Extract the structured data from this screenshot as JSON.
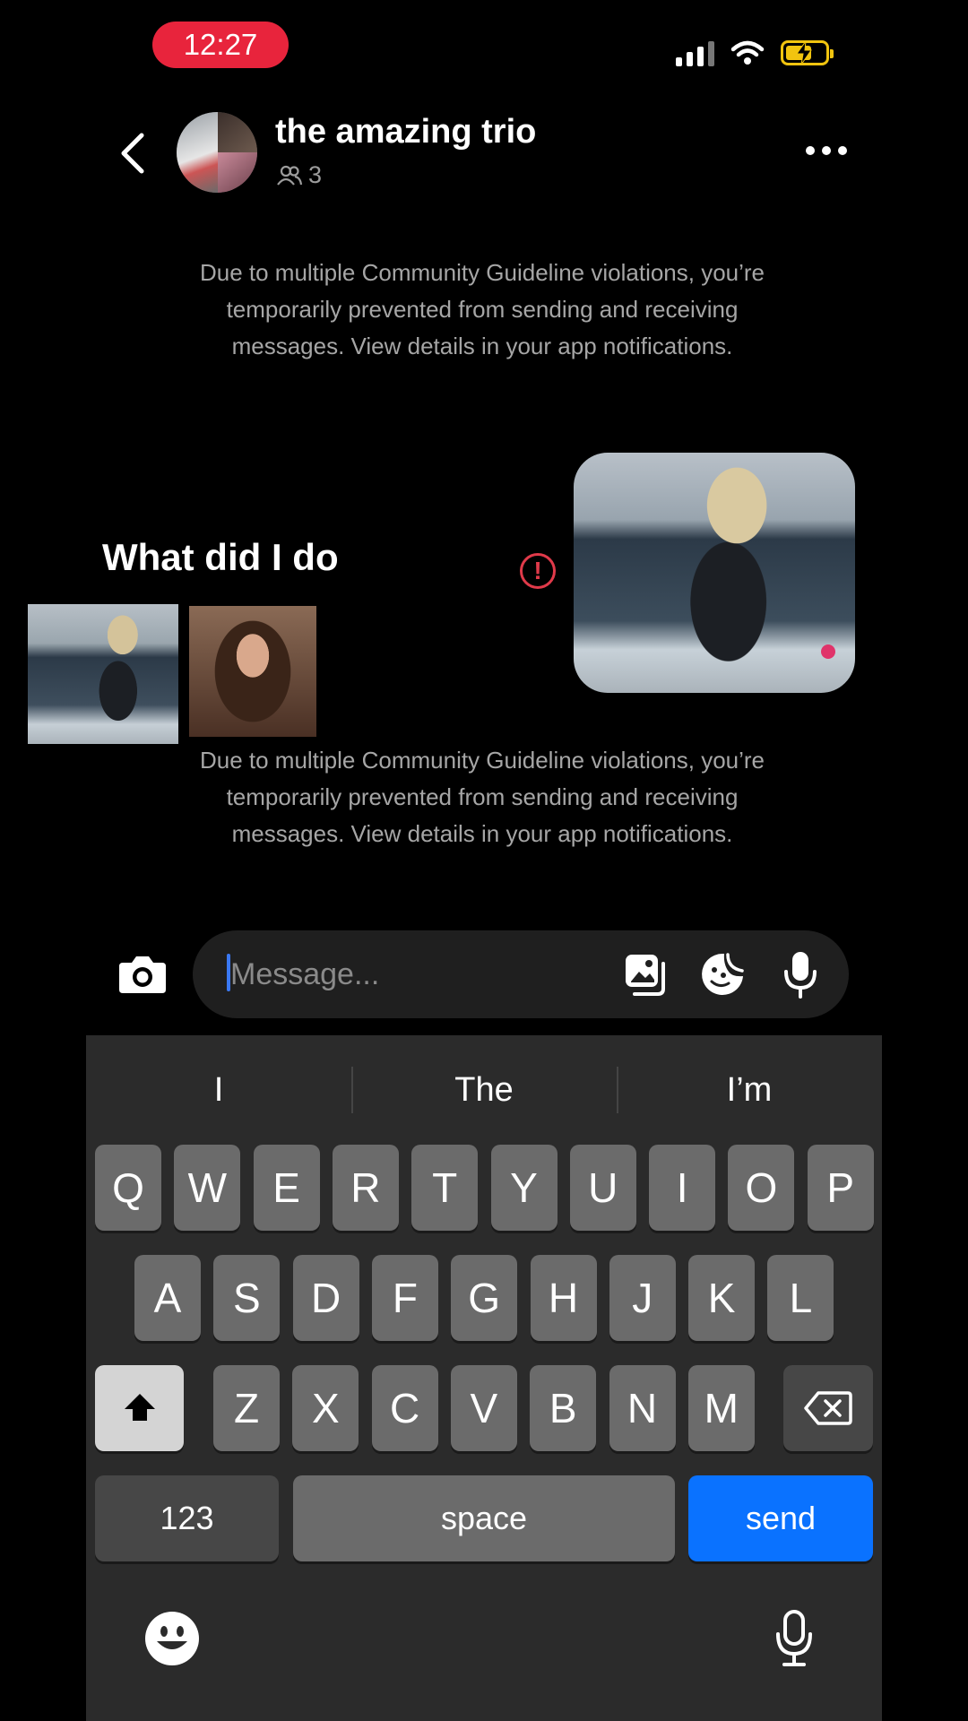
{
  "status_bar": {
    "time": "12:27"
  },
  "header": {
    "title": "the amazing trio",
    "member_count": "3"
  },
  "notices": [
    "Due to multiple Community Guideline violations, you’re temporarily prevented from sending and receiving messages. View details in your app notifications.",
    "Due to multiple Community Guideline violations, you’re temporarily prevented from sending and receiving messages. View details in your app notifications."
  ],
  "messages": {
    "received_text": "What did I do"
  },
  "composer": {
    "placeholder": "Message..."
  },
  "keyboard": {
    "suggestions": [
      "I",
      "The",
      "I’m"
    ],
    "row1": [
      "Q",
      "W",
      "E",
      "R",
      "T",
      "Y",
      "U",
      "I",
      "O",
      "P"
    ],
    "row2": [
      "A",
      "S",
      "D",
      "F",
      "G",
      "H",
      "J",
      "K",
      "L"
    ],
    "row3": [
      "Z",
      "X",
      "C",
      "V",
      "B",
      "N",
      "M"
    ],
    "numbers_label": "123",
    "space_label": "space",
    "send_label": "send"
  },
  "colors": {
    "accent": "#0a72ff",
    "error": "#e03a4a",
    "time_pill": "#e8243c",
    "battery": "#f1c40f"
  }
}
